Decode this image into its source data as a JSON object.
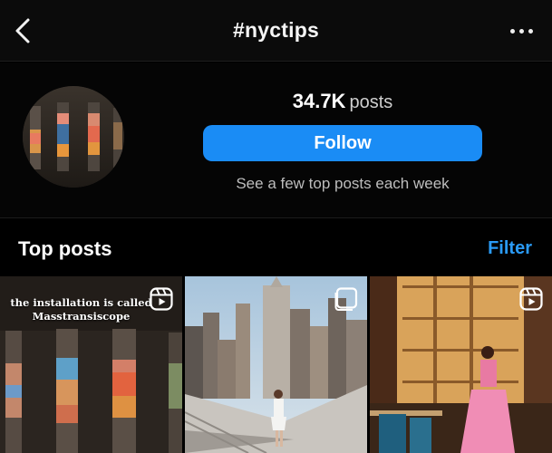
{
  "topbar": {
    "title": "#nyctips"
  },
  "header": {
    "posts_count": "34.7K",
    "posts_label": "posts",
    "follow_label": "Follow",
    "subtext": "See a few top posts each week"
  },
  "section": {
    "title": "Top posts",
    "filter_label": "Filter"
  },
  "posts": [
    {
      "caption_line1": "the installation is called",
      "caption_line2": "Masstransiscope",
      "type": "reel"
    },
    {
      "type": "carousel"
    },
    {
      "type": "reel"
    }
  ],
  "colors": {
    "accent": "#1a8cf5",
    "link": "#2a9bf7",
    "background": "#000000"
  }
}
